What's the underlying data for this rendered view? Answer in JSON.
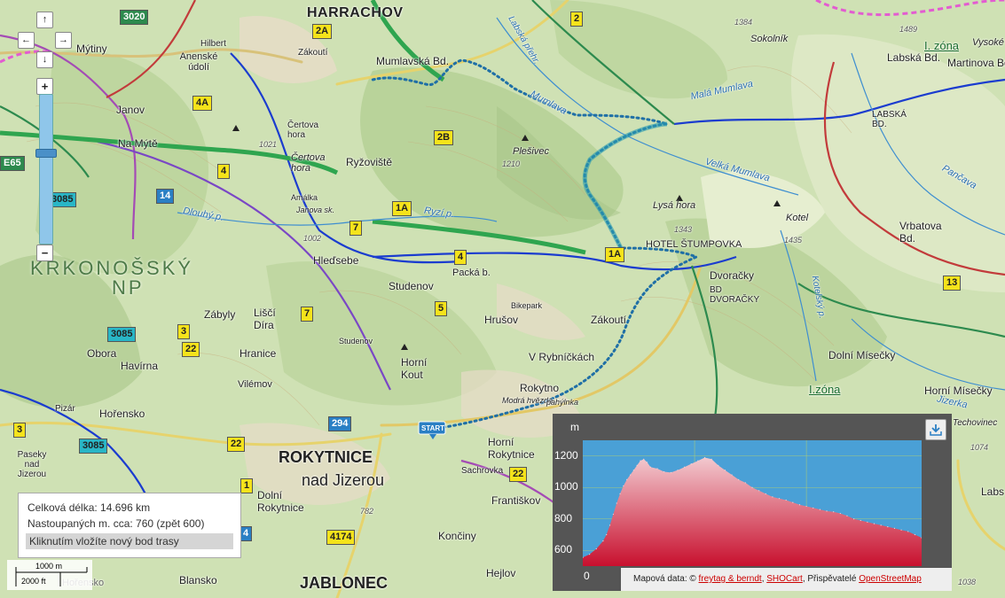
{
  "map": {
    "places": [
      {
        "key": "harrachov",
        "text": "HARRACHOV"
      },
      {
        "key": "mytiny",
        "text": "Mýtiny"
      },
      {
        "key": "hilbert",
        "text": "Hilbert"
      },
      {
        "key": "anenske",
        "text": "Anenské údolí"
      },
      {
        "key": "zakouti1",
        "text": "Zákoutí"
      },
      {
        "key": "mumlavska",
        "text": "Mumlavská Bd."
      },
      {
        "key": "janov",
        "text": "Janov"
      },
      {
        "key": "namyte",
        "text": "Na Mýtě"
      },
      {
        "key": "certova1",
        "text": "Čertova hora"
      },
      {
        "key": "certova2",
        "text": "Čertova hora"
      },
      {
        "key": "ryzoviste",
        "text": "Ryžoviště"
      },
      {
        "key": "plesivec",
        "text": "Plešivec"
      },
      {
        "key": "lysa",
        "text": "Lysá hora"
      },
      {
        "key": "hotel",
        "text": "HOTEL ŠTUMPOVKA"
      },
      {
        "key": "dvoracky",
        "text": "Dvoračky"
      },
      {
        "key": "bddvoracky",
        "text": "BD DVORAČKY"
      },
      {
        "key": "kotel",
        "text": "Kotel"
      },
      {
        "key": "sokolnik",
        "text": "Sokolník"
      },
      {
        "key": "labskabd",
        "text": "Labská Bd."
      },
      {
        "key": "martinova",
        "text": "Martinova Bd."
      },
      {
        "key": "labskabd2",
        "text": "LABSKÁ BD."
      },
      {
        "key": "vrbatova",
        "text": "Vrbatova Bd."
      },
      {
        "key": "krkonossky",
        "text": "KRKONOŠSKÝ"
      },
      {
        "key": "np",
        "text": "NP"
      },
      {
        "key": "hledsebe",
        "text": "Hleďsebe"
      },
      {
        "key": "studenov",
        "text": "Studenov"
      },
      {
        "key": "packa",
        "text": "Packá b."
      },
      {
        "key": "zabyly",
        "text": "Zábyly"
      },
      {
        "key": "liscidira",
        "text": "Liščí Díra"
      },
      {
        "key": "obora",
        "text": "Obora"
      },
      {
        "key": "havirna",
        "text": "Havírna"
      },
      {
        "key": "hranice",
        "text": "Hranice"
      },
      {
        "key": "vilemov",
        "text": "Vilémov"
      },
      {
        "key": "studenov2",
        "text": "Studenov"
      },
      {
        "key": "hornikout",
        "text": "Horní Kout"
      },
      {
        "key": "hrusov",
        "text": "Hrušov"
      },
      {
        "key": "bikepark",
        "text": "Bikepark"
      },
      {
        "key": "zakouti2",
        "text": "Zákoutí"
      },
      {
        "key": "vrybnickach",
        "text": "V Rybníčkách"
      },
      {
        "key": "rokytno",
        "text": "Rokytno"
      },
      {
        "key": "dolnimisecky",
        "text": "Dolní Mísečky"
      },
      {
        "key": "hornimisecky",
        "text": "Horní Mísečky"
      },
      {
        "key": "horensko",
        "text": "Hořensko"
      },
      {
        "key": "pizar",
        "text": "Pizár"
      },
      {
        "key": "paseky",
        "text": "Paseky nad Jizerou"
      },
      {
        "key": "rokytnice",
        "text": "ROKYTNICE"
      },
      {
        "key": "nadjizerou",
        "text": "nad Jizerou"
      },
      {
        "key": "hornirokytnice",
        "text": "Horní Rokytnice"
      },
      {
        "key": "sachrovka",
        "text": "Sachrovka"
      },
      {
        "key": "dolnirokytnice",
        "text": "Dolní Rokytnice"
      },
      {
        "key": "frantiskov",
        "text": "Františkov"
      },
      {
        "key": "konciny",
        "text": "Končiny"
      },
      {
        "key": "hejlov",
        "text": "Hejlov"
      },
      {
        "key": "blansko",
        "text": "Blansko"
      },
      {
        "key": "jablonec",
        "text": "JABLONEC"
      },
      {
        "key": "modrahvezda",
        "text": "Modrá hvězda"
      },
      {
        "key": "pahylnka",
        "text": "pahýlnka"
      },
      {
        "key": "amalka",
        "text": "Amálka"
      },
      {
        "key": "janovask",
        "text": "Janova sk."
      },
      {
        "key": "start",
        "text": "START"
      },
      {
        "key": "izona1",
        "text": "I. zóna"
      },
      {
        "key": "izona2",
        "text": "I.zóna"
      },
      {
        "key": "vysoke",
        "text": "Vysoké"
      },
      {
        "key": "labs",
        "text": "Labs"
      },
      {
        "key": "techovinec",
        "text": "Techovinec"
      },
      {
        "key": "horensko2",
        "text": "Hořensko"
      }
    ],
    "water": [
      {
        "key": "mumlava",
        "text": "Mumlava"
      },
      {
        "key": "labskadol",
        "text": "Labská přehr."
      },
      {
        "key": "velkamumlava",
        "text": "Velká Mumlava"
      },
      {
        "key": "malamumlava",
        "text": "Malá Mumlava"
      },
      {
        "key": "dlouhyp",
        "text": "Dlouhý p."
      },
      {
        "key": "ryzip",
        "text": "Ryzí p."
      },
      {
        "key": "pancava",
        "text": "Pančava"
      },
      {
        "key": "jizerka",
        "text": "Jizerka"
      },
      {
        "key": "kotelsky",
        "text": "Kotelský p."
      }
    ],
    "elevations": [
      {
        "key": "e1384",
        "text": "1384"
      },
      {
        "key": "e1489",
        "text": "1489"
      },
      {
        "key": "e1021",
        "text": "1021"
      },
      {
        "key": "e1210",
        "text": "1210"
      },
      {
        "key": "e1343",
        "text": "1343"
      },
      {
        "key": "e1435",
        "text": "1435"
      },
      {
        "key": "e1002",
        "text": "1002"
      },
      {
        "key": "e782",
        "text": "782"
      },
      {
        "key": "e1074",
        "text": "1074"
      },
      {
        "key": "e1038",
        "text": "1038"
      }
    ],
    "route_numbers": [
      {
        "key": "r3020",
        "text": "3020"
      },
      {
        "key": "r2",
        "text": "2"
      },
      {
        "key": "r2a",
        "text": "2A"
      },
      {
        "key": "r4a",
        "text": "4A"
      },
      {
        "key": "r2b",
        "text": "2B"
      },
      {
        "key": "re65",
        "text": "E65"
      },
      {
        "key": "r3085a",
        "text": "3085"
      },
      {
        "key": "r14",
        "text": "14"
      },
      {
        "key": "r4a2",
        "text": "4"
      },
      {
        "key": "r1a",
        "text": "1A"
      },
      {
        "key": "r7",
        "text": "7"
      },
      {
        "key": "r4b",
        "text": "4"
      },
      {
        "key": "r1a2",
        "text": "1A"
      },
      {
        "key": "r5",
        "text": "5"
      },
      {
        "key": "r7b",
        "text": "7"
      },
      {
        "key": "r3085b",
        "text": "3085"
      },
      {
        "key": "r3a",
        "text": "3"
      },
      {
        "key": "r22a",
        "text": "22"
      },
      {
        "key": "r3b",
        "text": "3"
      },
      {
        "key": "r3085c",
        "text": "3085"
      },
      {
        "key": "r294",
        "text": "294"
      },
      {
        "key": "r22b",
        "text": "22"
      },
      {
        "key": "r22c",
        "text": "22"
      },
      {
        "key": "r4174",
        "text": "4174"
      },
      {
        "key": "r13",
        "text": "13"
      },
      {
        "key": "r4c",
        "text": "4"
      },
      {
        "key": "r1",
        "text": "1"
      }
    ],
    "route_color": "#1f6fa6",
    "track_color": "#2a9db0"
  },
  "nav": {
    "up": "↑",
    "down": "↓",
    "left": "←",
    "right": "→",
    "zoom_in": "+",
    "zoom_out": "−"
  },
  "info": {
    "total_length": "Celková délka: 14.696 km",
    "ascent": "Nastoupaných m. cca: 760 (zpět 600)",
    "hint": "Kliknutím vložíte nový bod trasy"
  },
  "scale": {
    "metric": "1000 m",
    "imperial": "2000 ft"
  },
  "chart_data": {
    "type": "area",
    "title": "",
    "xlabel": "",
    "ylabel": "m",
    "ylim": [
      500,
      1300
    ],
    "yticks": [
      600,
      800,
      1000,
      1200
    ],
    "x": [
      0,
      2,
      4,
      6,
      7,
      8,
      9,
      10,
      11,
      12,
      13,
      14,
      15,
      16,
      17,
      18,
      19,
      20,
      22,
      24,
      26,
      28,
      30,
      32,
      34,
      36,
      38,
      40,
      42,
      44,
      46,
      48,
      50,
      52,
      54,
      56,
      58,
      60,
      62,
      64,
      66,
      68,
      70,
      72,
      74,
      76,
      78,
      80,
      82,
      84,
      86,
      88,
      90,
      92,
      94,
      96,
      98,
      100
    ],
    "series": [
      {
        "values": [
          555,
          575,
          610,
          660,
          700,
          760,
          830,
          900,
          960,
          1010,
          1050,
          1080,
          1110,
          1140,
          1170,
          1180,
          1160,
          1130,
          1120,
          1100,
          1095,
          1110,
          1130,
          1150,
          1170,
          1190,
          1180,
          1140,
          1110,
          1080,
          1050,
          1030,
          1000,
          980,
          960,
          940,
          930,
          920,
          905,
          890,
          880,
          870,
          860,
          850,
          845,
          835,
          820,
          800,
          790,
          780,
          770,
          760,
          750,
          740,
          730,
          720,
          700,
          680
        ]
      }
    ],
    "x_tick_labels": [
      "0"
    ],
    "fill_colors": [
      "#f2c9cf",
      "#c8102e"
    ],
    "sky_color": "#4aa0d6"
  },
  "elevation_panel": {
    "unit": "m",
    "zero": "0",
    "footer_prefix": "Mapová data: ©",
    "footer_link1": "freytag & berndt",
    "footer_sep1": ",",
    "footer_link2": "SHOCart",
    "footer_mid": ", Přispěvatelé",
    "footer_link3": "OpenStreetMap"
  }
}
